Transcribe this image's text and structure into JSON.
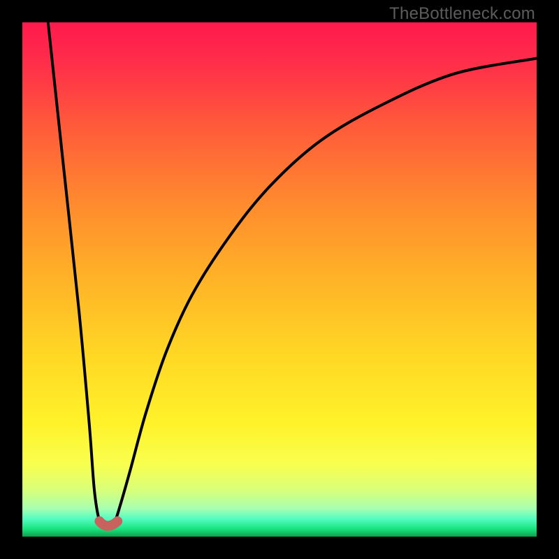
{
  "watermark": "TheBottleneck.com",
  "colors": {
    "bg": "#000000",
    "gradient_stops": [
      {
        "offset": 0.0,
        "color": "#ff1a4d"
      },
      {
        "offset": 0.08,
        "color": "#ff2e4a"
      },
      {
        "offset": 0.2,
        "color": "#ff5a3a"
      },
      {
        "offset": 0.35,
        "color": "#ff8a2e"
      },
      {
        "offset": 0.5,
        "color": "#ffb327"
      },
      {
        "offset": 0.65,
        "color": "#ffd824"
      },
      {
        "offset": 0.78,
        "color": "#fff22a"
      },
      {
        "offset": 0.86,
        "color": "#f8ff4f"
      },
      {
        "offset": 0.91,
        "color": "#d8ff7a"
      },
      {
        "offset": 0.945,
        "color": "#a8ffb0"
      },
      {
        "offset": 0.965,
        "color": "#55fcc2"
      },
      {
        "offset": 0.985,
        "color": "#18e47e"
      },
      {
        "offset": 1.0,
        "color": "#0fa04d"
      }
    ],
    "curve_stroke": "#000000",
    "marker_stroke": "#c9615f",
    "marker_fill_opacity": 0.0
  },
  "chart_data": {
    "type": "line",
    "title": "",
    "xlabel": "",
    "ylabel": "",
    "xlim": [
      0,
      100
    ],
    "ylim": [
      0,
      100
    ],
    "x_at_min": 16,
    "x_at_min_range": [
      14,
      19
    ],
    "y_min": 2,
    "left_start": {
      "x": 5,
      "y": 100
    },
    "right_end": {
      "x": 100,
      "y": 93
    },
    "right_knee": {
      "x": 38,
      "y": 50
    },
    "series": [
      {
        "name": "bottleneck-curve",
        "points": [
          {
            "x": 5,
            "y": 100
          },
          {
            "x": 8,
            "y": 72
          },
          {
            "x": 11,
            "y": 44
          },
          {
            "x": 13,
            "y": 22
          },
          {
            "x": 14,
            "y": 9
          },
          {
            "x": 15,
            "y": 3
          },
          {
            "x": 16,
            "y": 2
          },
          {
            "x": 17,
            "y": 2
          },
          {
            "x": 18,
            "y": 3
          },
          {
            "x": 19,
            "y": 6
          },
          {
            "x": 21,
            "y": 13
          },
          {
            "x": 24,
            "y": 24
          },
          {
            "x": 28,
            "y": 36
          },
          {
            "x": 33,
            "y": 47
          },
          {
            "x": 40,
            "y": 58
          },
          {
            "x": 48,
            "y": 68
          },
          {
            "x": 58,
            "y": 77
          },
          {
            "x": 70,
            "y": 84
          },
          {
            "x": 84,
            "y": 90
          },
          {
            "x": 100,
            "y": 93
          }
        ]
      }
    ],
    "markers": [
      {
        "x": 15.0,
        "y": 3.0
      },
      {
        "x": 16.5,
        "y": 2.0
      },
      {
        "x": 18.5,
        "y": 3.0
      }
    ]
  }
}
